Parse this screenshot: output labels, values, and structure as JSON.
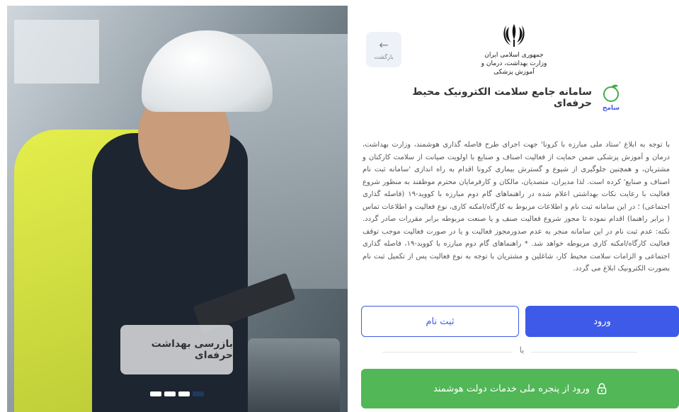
{
  "hero": {
    "caption": "بازرسی بهداشت حرفه‌ای",
    "slides": [
      {
        "active": false
      },
      {
        "active": false
      },
      {
        "active": false
      },
      {
        "active": true
      }
    ]
  },
  "header": {
    "back_label": "بازگشت",
    "ministry_line1": "جمهوری اسلامی ایران",
    "ministry_line2": "وزارت بهداشت، درمان و آموزش پزشکی",
    "app_title": "سامانه جامع سلامت الکترونیک محیط حرفه‌ای",
    "logo_text": "سامح"
  },
  "body_text": "با توجه به ابلاغ 'ستاد ملی مبارزه با کرونا' جهت اجرای طرح فاصله گذاری هوشمند، وزارت بهداشت، درمان و آموزش پزشکی ضمن حمایت از فعالیت اصناف و صنایع با اولویت صیانت از سلامت کارکنان و مشتریان، و همچنین جلوگیری از شیوع و گسترش بیماری کرونا اقدام به راه اندازی 'سامانه ثبت نام اصناف و صنایع' کرده است. لذا مدیران، متصدیان، مالکان و کارفرمایان محترم موظفند به منظور شروع فعالیت با رعایت نکات بهداشتی اعلام شده در راهنماهای گام دوم مبارزه با کووید-۱۹ (فاصله گذاری اجتماعی) ؛ در این سامانه ثبت نام و اطلاعات مربوط به کارگاه/امکنه کاری، نوع فعالیت و اطلاعات تماس ( برابر راهنما) اقدام نموده تا مجوز شروع فعالیت صنف و یا صنعت مربوطه برابر مقررات صادر گردد. نکته: عدم ثبت نام در این سامانه منجر به عدم صدورمجوز فعالیت و یا در صورت فعالیت موجب توقف فعالیت کارگاه/امکنه کاری مربوطه خواهد شد. * راهنماهای گام دوم مبارزه با کووید-۱۹، فاصله گذاری اجتماعی و الزامات سلامت محیط کار، شاغلین و مشتریان با توجه به نوع فعالیت پس از تکمیل ثبت نام بصورت الکترونیک ابلاغ می گردد.",
  "actions": {
    "login_label": "ورود",
    "register_label": "ثبت نام",
    "or_label": "یا",
    "gov_login_label": "ورود از پنجره ملی خدمات دولت هوشمند"
  },
  "colors": {
    "primary": "#3d5ae8",
    "success": "#52b757",
    "back_bg": "#eef2f8"
  }
}
